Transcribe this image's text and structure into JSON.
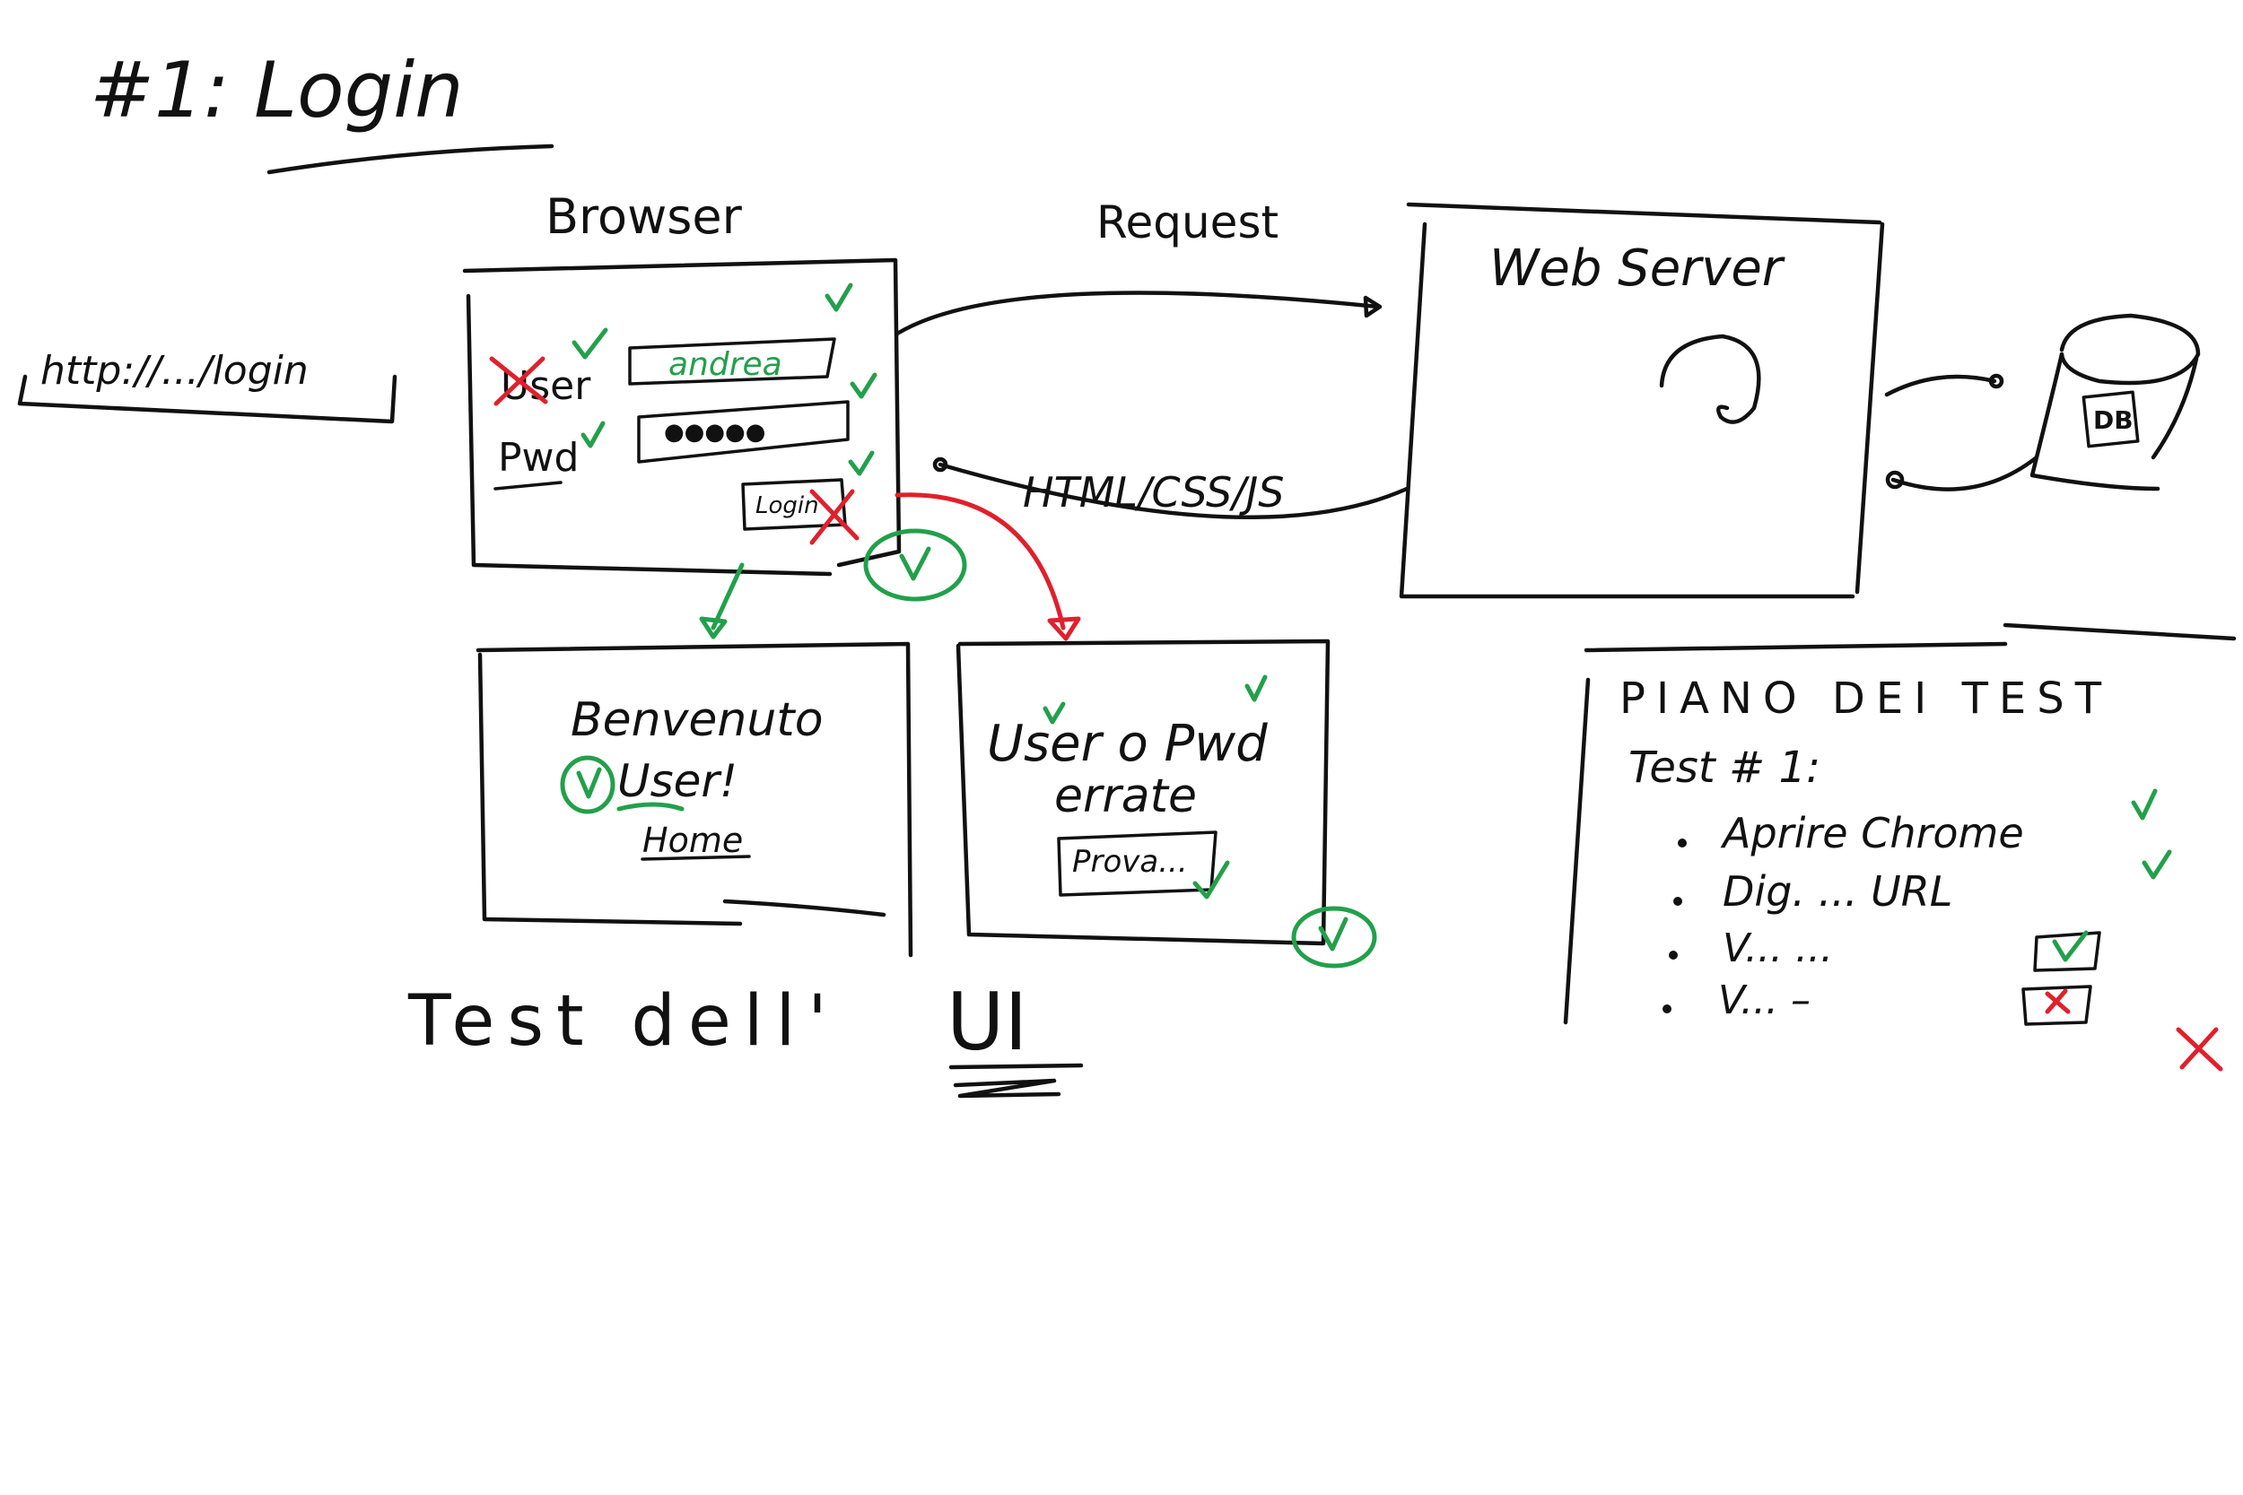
{
  "title": "#1: Login",
  "url_bar": {
    "text": "http://.../login"
  },
  "browser": {
    "label": "Browser",
    "user_label": "User",
    "user_value": "andrea",
    "pwd_label": "Pwd",
    "pwd_value": "●●●●●",
    "login_button": "Login"
  },
  "request_label": "Request",
  "response_label": "HTML/CSS/JS",
  "web_server": {
    "label": "Web Server"
  },
  "database": {
    "icon": "database-icon",
    "glyph": "DB"
  },
  "success_page": {
    "line1": "Benvenuto",
    "line2": "User!",
    "link": "Home"
  },
  "error_page": {
    "line1": "User o Pwd",
    "line2": "errate",
    "button": "Prova..."
  },
  "caption": {
    "prefix": "Test dell'",
    "emphasis": "UI"
  },
  "test_plan": {
    "title": "PIANO DEI TEST",
    "subtitle": "Test # 1:",
    "steps": [
      {
        "text": "Aprire Chrome",
        "status": "pass"
      },
      {
        "text": "Dig. ... URL",
        "status": "pass"
      },
      {
        "text": "V... ...",
        "status": "pass"
      },
      {
        "text": "V... –",
        "status": "fail"
      }
    ]
  },
  "colors": {
    "ink": "#111111",
    "pass": "#22a04b",
    "fail": "#e0202c"
  }
}
